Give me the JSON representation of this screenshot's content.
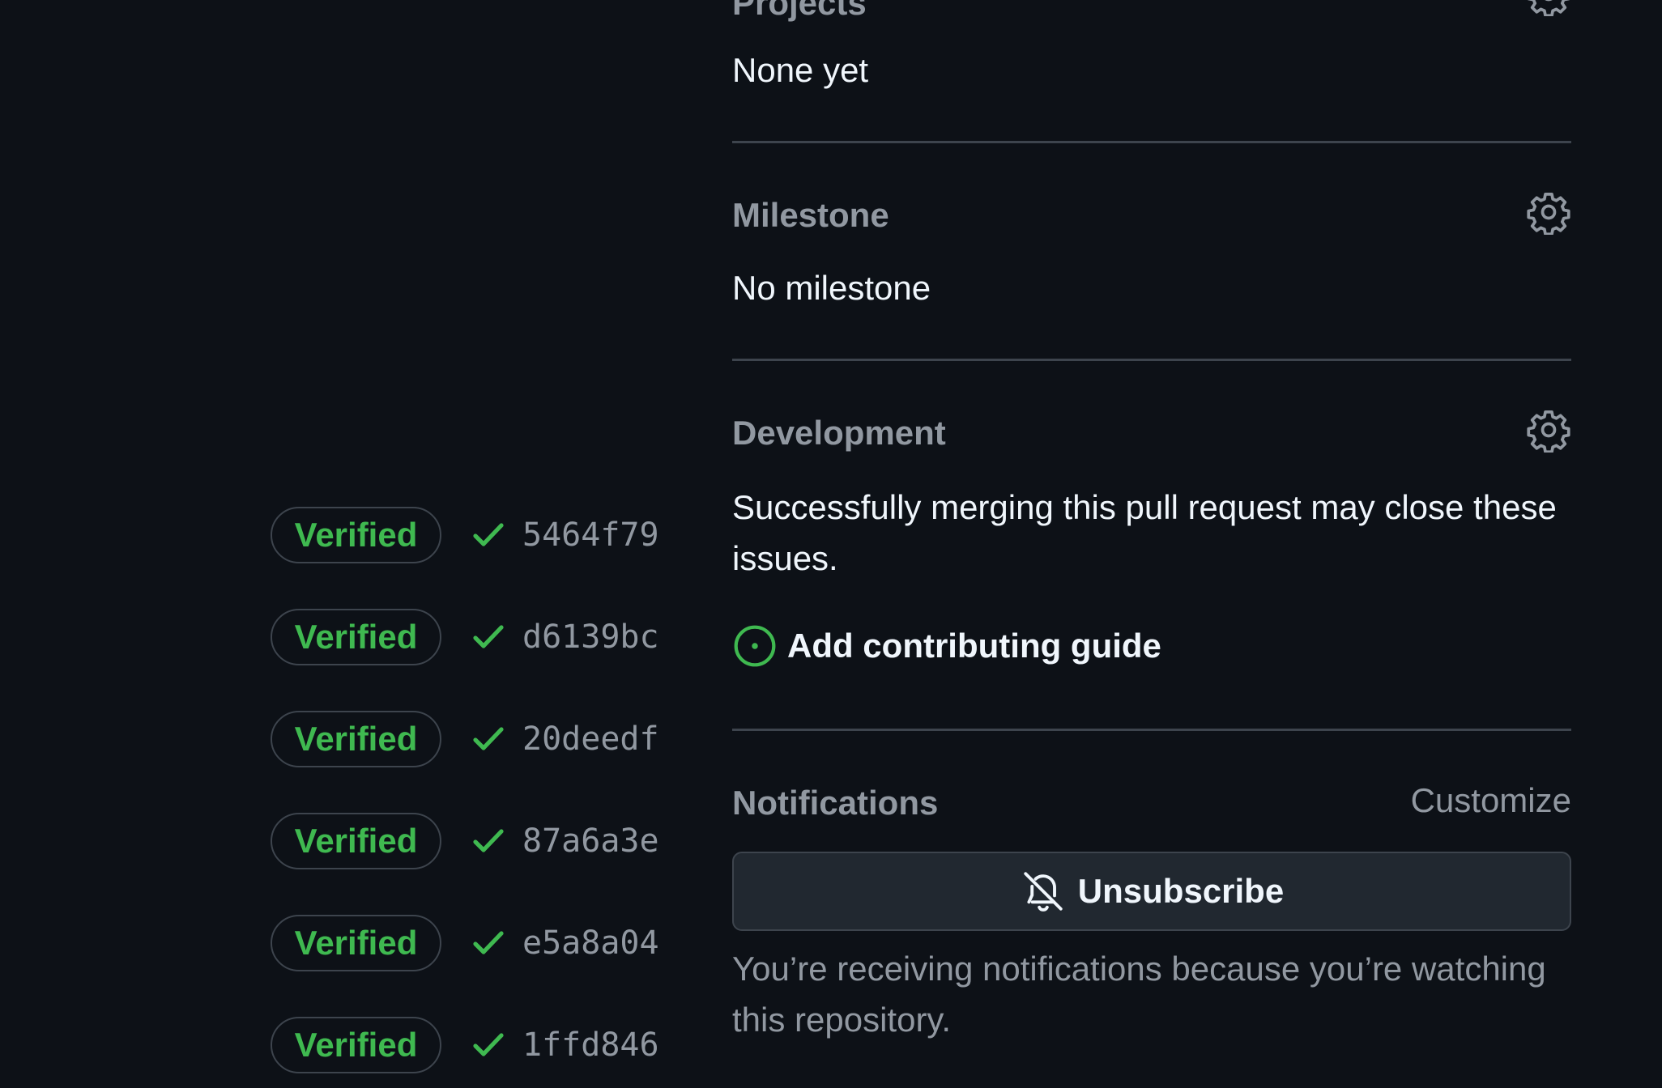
{
  "commits": [
    {
      "badge": "Verified",
      "sha": "5464f79"
    },
    {
      "badge": "Verified",
      "sha": "d6139bc"
    },
    {
      "badge": "Verified",
      "sha": "20deedf"
    },
    {
      "badge": "Verified",
      "sha": "87a6a3e"
    },
    {
      "badge": "Verified",
      "sha": "e5a8a04"
    },
    {
      "badge": "Verified",
      "sha": "1ffd846"
    }
  ],
  "sidebar": {
    "projects": {
      "title": "Projects",
      "value": "None yet"
    },
    "milestone": {
      "title": "Milestone",
      "value": "No milestone"
    },
    "development": {
      "title": "Development",
      "description": "Successfully merging this pull request may close these issues.",
      "issue_title": "Add contributing guide"
    },
    "notifications": {
      "title": "Notifications",
      "customize_label": "Customize",
      "unsubscribe_label": "Unsubscribe",
      "note": "You’re receiving notifications because you’re watching this repository."
    }
  },
  "colors": {
    "background": "#0d1117",
    "verified": "#3fb950",
    "muted": "#9198a1"
  }
}
